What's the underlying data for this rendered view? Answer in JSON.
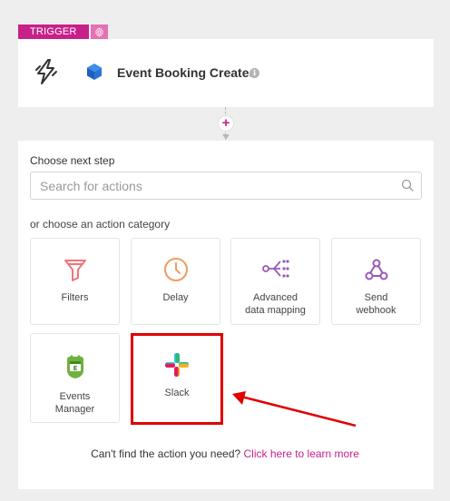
{
  "trigger": {
    "tag": "TRIGGER",
    "title": "Event Booking Created"
  },
  "search": {
    "label": "Choose next step",
    "placeholder": "Search for actions"
  },
  "categories_label": "or choose an action category",
  "categories": [
    {
      "label": "Filters",
      "icon": "filter-icon"
    },
    {
      "label": "Delay",
      "icon": "clock-icon"
    },
    {
      "label": "Advanced\ndata mapping",
      "icon": "data-mapping-icon"
    },
    {
      "label": "Send\nwebhook",
      "icon": "webhook-icon"
    },
    {
      "label": "Events\nManager",
      "icon": "events-manager-icon"
    },
    {
      "label": "Slack",
      "icon": "slack-icon"
    }
  ],
  "footer": {
    "text": "Can't find the action you need?",
    "link": "Click here to learn more"
  },
  "colors": {
    "accent": "#c8208a",
    "filter": "#f2747a",
    "delay": "#f29b5e",
    "mapping": "#9b59b6",
    "annotation": "#e00000"
  }
}
